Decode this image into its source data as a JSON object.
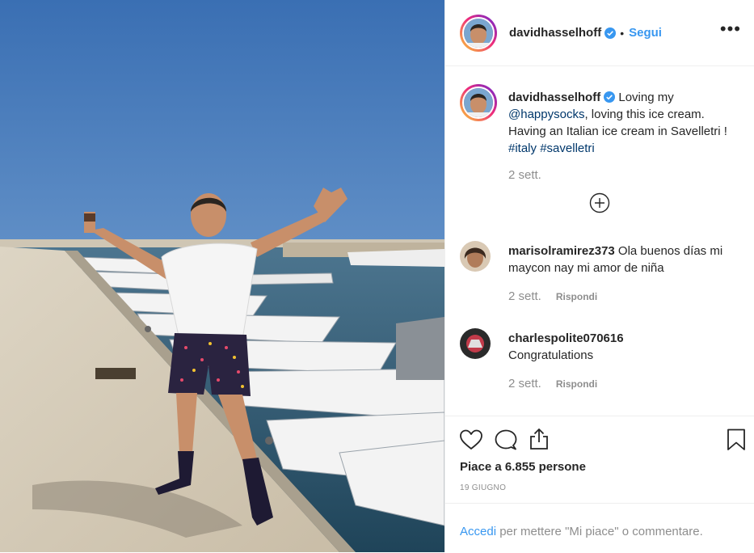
{
  "post": {
    "username": "davidhasselhoff",
    "follow_dot": "•",
    "follow_label": "Segui",
    "more_label": "•••"
  },
  "caption": {
    "username": "davidhasselhoff",
    "text_1": " Loving my ",
    "mention": "@happysocks",
    "text_2": ", loving this ice cream. Having an Italian ice cream in Savelletri ! ",
    "hashtag_1": "#italy",
    "space": " ",
    "hashtag_2": "#savelletri",
    "time": "2 sett."
  },
  "comments": [
    {
      "username": "marisolramirez373",
      "text": " Ola buenos días mi maycon nay mi amor de niña",
      "time": "2 sett.",
      "reply_label": "Rispondi"
    },
    {
      "username": "charlespolite070616",
      "text": "Congratulations",
      "time": "2 sett.",
      "reply_label": "Rispondi"
    }
  ],
  "actions": {
    "likes": "Piace a 6.855 persone",
    "date": "19 GIUGNO"
  },
  "login": {
    "link": "Accedi",
    "rest": " per mettere \"Mi piace\" o commentare."
  },
  "icons": {
    "verified": "verified-badge-icon",
    "load_more": "plus-circle-icon",
    "like": "heart-icon",
    "comment": "comment-icon",
    "share": "share-icon",
    "save": "bookmark-icon"
  },
  "colors": {
    "accent": "#3897f0",
    "text": "#262626",
    "muted": "#8e8e8e",
    "border": "#efefef",
    "link": "#00376b"
  }
}
